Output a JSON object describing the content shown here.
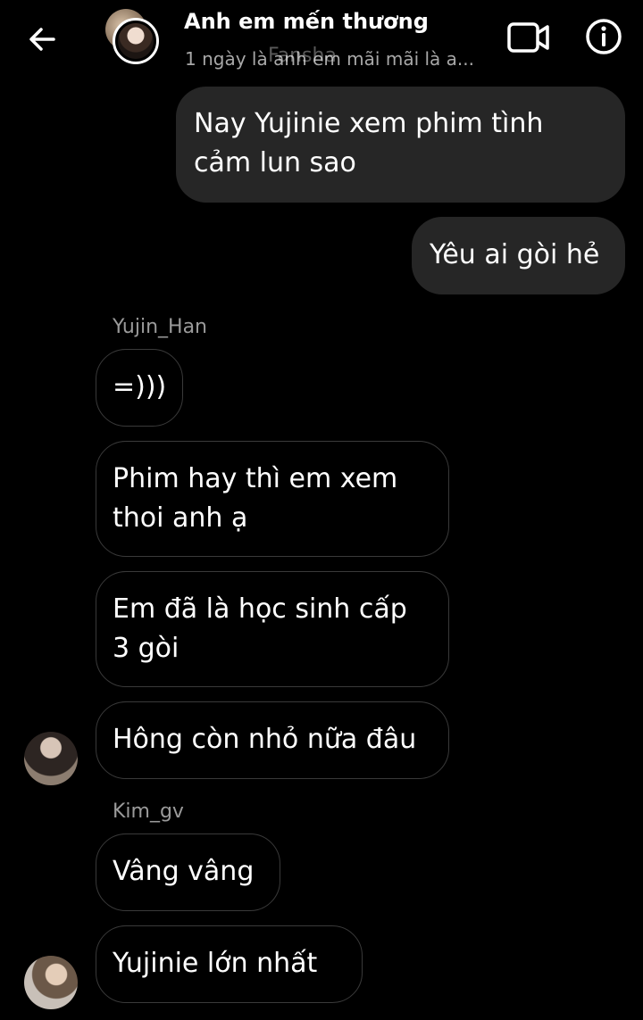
{
  "header": {
    "back_icon": "arrow-left-icon",
    "title": "Anh em mến thương",
    "subtitle": "1 ngày là anh em mãi mãi là a...",
    "watermark": "Fansha",
    "video_icon": "video-camera-icon",
    "info_icon": "info-icon"
  },
  "messages": {
    "out": [
      {
        "lines": [
          "Nay Yujinie xem phim tình",
          "cảm lun sao"
        ]
      },
      {
        "lines": [
          "Yêu ai gòi hẻ"
        ]
      }
    ],
    "sender1": "Yujin_Han",
    "in1": [
      {
        "lines": [
          "=)))"
        ]
      },
      {
        "lines": [
          "Phim hay thì em xem",
          "thoi anh ạ"
        ]
      },
      {
        "lines": [
          "Em đã là học sinh cấp",
          "3 gòi"
        ]
      },
      {
        "lines": [
          "Hông còn nhỏ nữa đâu"
        ]
      }
    ],
    "sender2": "Kim_gv",
    "in2": [
      {
        "lines": [
          "Vâng vâng"
        ]
      },
      {
        "lines": [
          "Yujinie lớn nhất"
        ]
      }
    ]
  },
  "colors": {
    "background": "#000000",
    "outgoing_bubble": "#262626",
    "incoming_border": "#3a3a3a",
    "sender_text": "#9a9a9a"
  }
}
